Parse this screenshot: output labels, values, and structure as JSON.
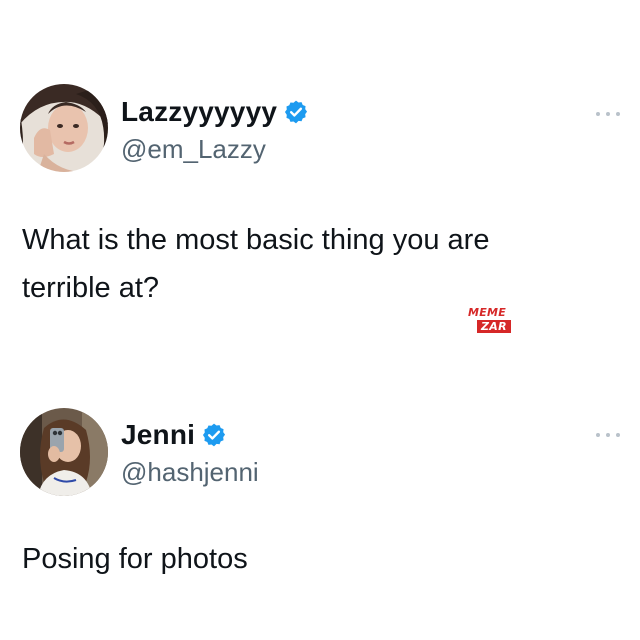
{
  "colors": {
    "text": "#0f1419",
    "secondary_text": "#536471",
    "verified_blue": "#1d9bf0",
    "watermark_red": "#d62828",
    "background": "#ffffff"
  },
  "tweets": [
    {
      "display_name": "Lazzyyyyyy",
      "handle": "@em_Lazzy",
      "verified": true,
      "verified_icon": "verified-badge-icon",
      "more_icon": "more-options-icon",
      "text": "What is the most basic thing you are terrible at?"
    },
    {
      "display_name": "Jenni",
      "handle": "@hashjenni",
      "verified": true,
      "verified_icon": "verified-badge-icon",
      "more_icon": "more-options-icon",
      "text": "Posing for photos"
    }
  ],
  "watermark": {
    "line1": "MEME",
    "line2": "ZAR"
  }
}
